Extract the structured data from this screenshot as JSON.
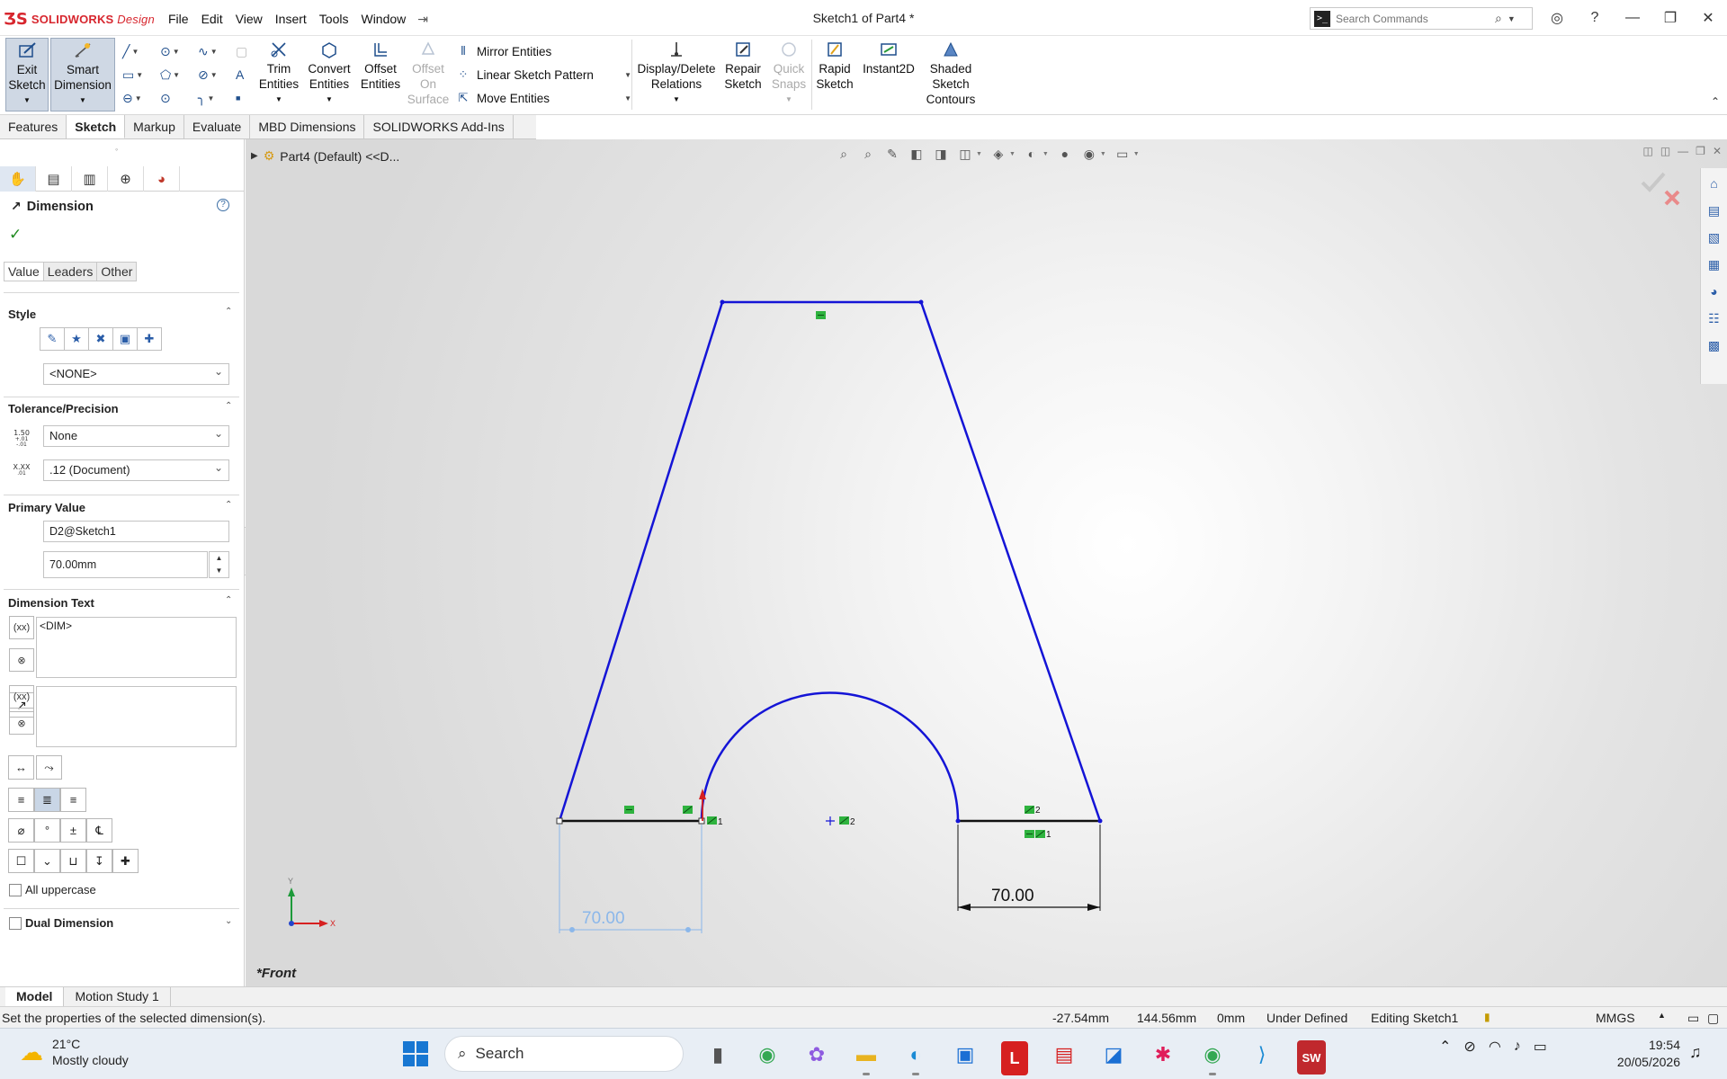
{
  "app": {
    "brand": "SOLIDWORKS",
    "brand_suffix": "Design",
    "doc_title": "Sketch1 of Part4 *",
    "search_placeholder": "Search Commands",
    "menu": [
      "File",
      "Edit",
      "View",
      "Insert",
      "Tools",
      "Window"
    ]
  },
  "ribbon": {
    "exit_sketch": "Exit\nSketch",
    "smart_dimension": "Smart\nDimension",
    "trim": "Trim\nEntities",
    "convert": "Convert\nEntities",
    "offset": "Offset\nEntities",
    "offset_surface": "Offset\nOn\nSurface",
    "mirror": "Mirror Entities",
    "linear_pattern": "Linear Sketch Pattern",
    "move": "Move Entities",
    "display_delete": "Display/Delete\nRelations",
    "repair": "Repair\nSketch",
    "quick_snaps": "Quick\nSnaps",
    "rapid_sketch": "Rapid\nSketch",
    "instant2d": "Instant2D",
    "shaded_contours": "Shaded\nSketch\nContours"
  },
  "tabs": [
    "Features",
    "Sketch",
    "Markup",
    "Evaluate",
    "MBD Dimensions",
    "SOLIDWORKS Add-Ins"
  ],
  "active_tab": "Sketch",
  "property_manager": {
    "title": "Dimension",
    "sub_tabs": [
      "Value",
      "Leaders",
      "Other"
    ],
    "style": {
      "title": "Style",
      "value": "<NONE>"
    },
    "tolerance": {
      "title": "Tolerance/Precision",
      "tolerance_type": "None",
      "precision": ".12 (Document)",
      "icon_tol_top": "1.50",
      "icon_tol_bottom": "+.01\n-.01",
      "icon_prec_top": "X.XX",
      "icon_prec_bottom": ".01"
    },
    "primary_value": {
      "title": "Primary Value",
      "name": "D2@Sketch1",
      "value": "70.00mm"
    },
    "dimension_text": {
      "title": "Dimension Text",
      "text": "<DIM>"
    },
    "all_uppercase": "All uppercase",
    "dual_dimension": "Dual Dimension"
  },
  "graphics": {
    "breadcrumb": "Part4 (Default) <<D...",
    "view_label": "*Front",
    "dim_left": "70.00",
    "dim_right": "70.00",
    "axis_y": "Y",
    "axis_x": "X",
    "relation_labels": {
      "left_coincident": "1",
      "center_coincident": "2",
      "right_top": "2",
      "right_bottom": "1"
    }
  },
  "bottom_tabs": [
    "Model",
    "Motion Study 1"
  ],
  "status": {
    "message": "Set the properties of the selected dimension(s).",
    "x": "-27.54mm",
    "y": "144.56mm",
    "z": "0mm",
    "state": "Under Defined",
    "editing": "Editing Sketch1",
    "units": "MMGS"
  },
  "taskbar": {
    "temperature": "21°C",
    "weather": "Mostly cloudy",
    "search": "Search",
    "time": "19:54",
    "date": "20/05/2026"
  }
}
